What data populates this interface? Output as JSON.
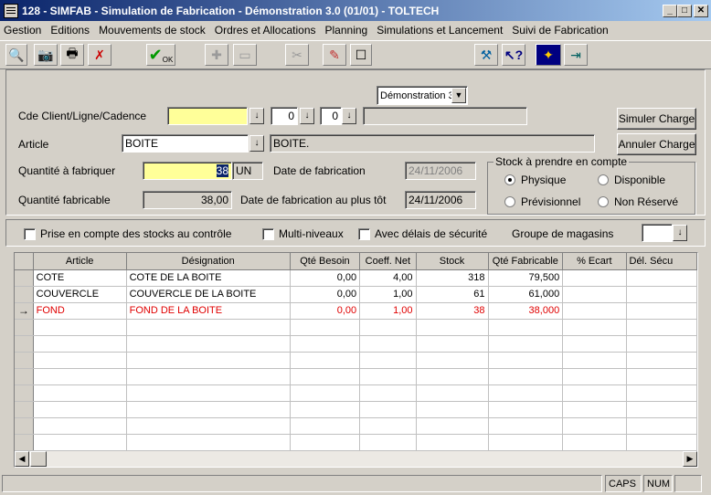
{
  "window": {
    "title": "128 - SIMFAB - Simulation de Fabrication - Démonstration 3.0 (01/01) - TOLTECH",
    "min": "_",
    "max": "□",
    "close": "✕"
  },
  "menu": [
    "Gestion",
    "Editions",
    "Mouvements de stock",
    "Ordres et Allocations",
    "Planning",
    "Simulations et Lancement",
    "Suivi de Fabrication"
  ],
  "toolbar": {
    "company_select": "Démonstration 3",
    "ok_label": "OK",
    "icons": [
      "find-icon",
      "camera-icon",
      "printer-icon",
      "cancel-doc-icon",
      "ok-check-icon",
      "add-icon",
      "copy-icon",
      "cut-icon",
      "eraser-icon",
      "new-icon",
      "tools-icon",
      "help-icon",
      "wizard-icon",
      "exit-icon"
    ]
  },
  "form": {
    "cde_label": "Cde Client/Ligne/Cadence",
    "cde_value": "",
    "ligne_value": "0",
    "cadence_value": "0",
    "cde_desc": "",
    "article_label": "Article",
    "article_value": "BOITE",
    "article_desc": "BOITE.",
    "qte_fab_label": "Quantité à fabriquer",
    "qte_fab_value": "38",
    "unit": "UN",
    "date_fab_label": "Date de fabrication",
    "date_fab_value": "24/11/2006",
    "qte_fabricable_label": "Quantité fabricable",
    "qte_fabricable_value": "38,00",
    "date_tot_label": "Date de fabrication au plus tôt",
    "date_tot_value": "24/11/2006",
    "simuler_label": "Simuler Charge",
    "annuler_label": "Annuler Charge",
    "stock_group": {
      "title": "Stock à prendre en compte",
      "options": [
        "Physique",
        "Disponible",
        "Prévisionnel",
        "Non Réservé"
      ],
      "selected": "Physique"
    }
  },
  "options": {
    "prise": "Prise en compte des stocks au contrôle",
    "multi": "Multi-niveaux",
    "delais": "Avec délais de sécurité",
    "groupe_label": "Groupe de magasins",
    "groupe_value": ""
  },
  "table": {
    "columns": [
      "Article",
      "Désignation",
      "Qté Besoin",
      "Coeff. Net",
      "Stock",
      "Qté Fabricable",
      "% Ecart",
      "Dél. Sécu"
    ],
    "rows": [
      {
        "indicator": "",
        "cells": [
          "COTE",
          "COTE DE LA BOITE",
          "0,00",
          "4,00",
          "318",
          "79,500",
          "",
          ""
        ]
      },
      {
        "indicator": "",
        "cells": [
          "COUVERCLE",
          "COUVERCLE DE LA BOITE",
          "0,00",
          "1,00",
          "61",
          "61,000",
          "",
          ""
        ]
      },
      {
        "indicator": "→",
        "cells": [
          "FOND",
          "FOND DE LA BOITE",
          "0,00",
          "1,00",
          "38",
          "38,000",
          "",
          ""
        ],
        "highlight": "#e00000"
      }
    ],
    "empty_rows": 9
  },
  "status": {
    "caps": "CAPS",
    "num": "NUM"
  }
}
